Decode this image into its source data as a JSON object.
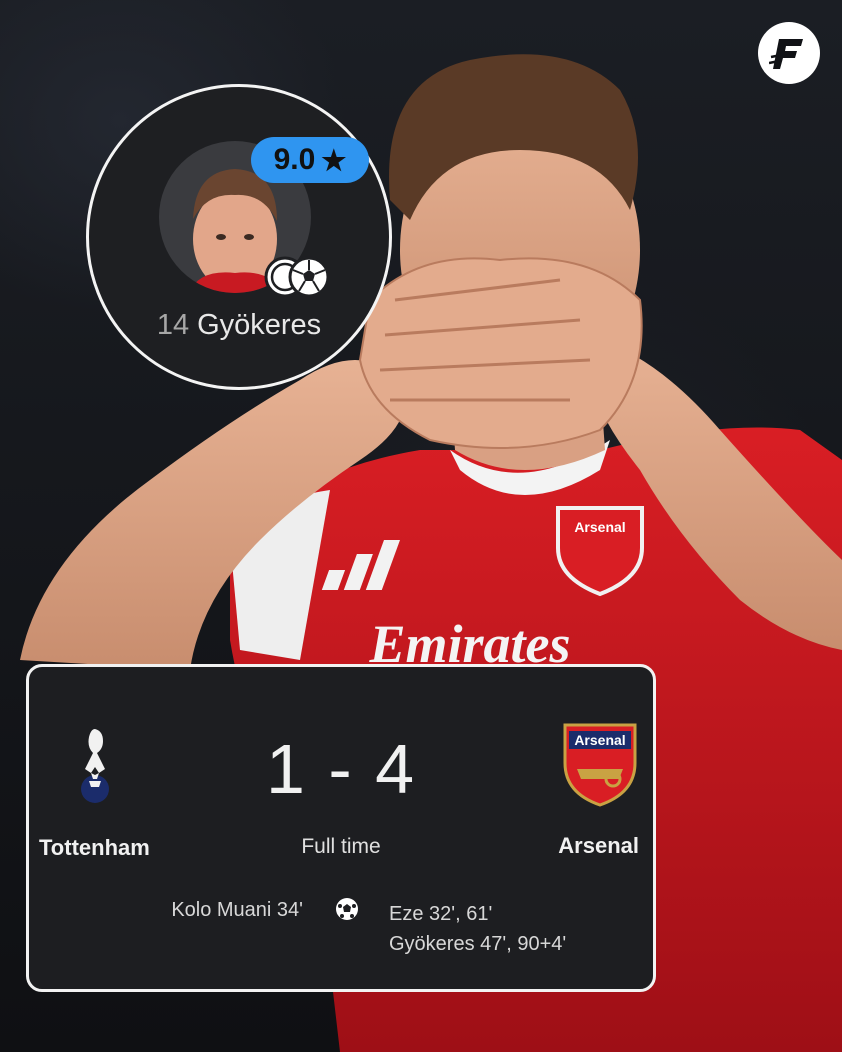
{
  "brand": {
    "logo_icon": "f-brand-logo-icon"
  },
  "player_card": {
    "rating": "9.0",
    "rating_icon": "star-icon",
    "shirt_number": "14",
    "name": "Gyökeres",
    "goal_icons": "two-goals-icon",
    "badge_color": "#2f95f0"
  },
  "match": {
    "home_team": "Tottenham",
    "away_team": "Arsenal",
    "score": "1 - 4",
    "status": "Full time",
    "home_scorers": [
      "Kolo Muani 34'"
    ],
    "away_scorers": [
      "Eze 32', 61'",
      "Gyökeres 47', 90+4'"
    ],
    "home_crest": "tottenham-crest-icon",
    "away_crest": "arsenal-crest-icon",
    "away_crest_text": "Arsenal",
    "goal_icon": "football-icon"
  },
  "photo": {
    "jersey_sponsor": "Emirates",
    "jersey_badge": "Arsenal",
    "kit_color": "#d0141c"
  }
}
